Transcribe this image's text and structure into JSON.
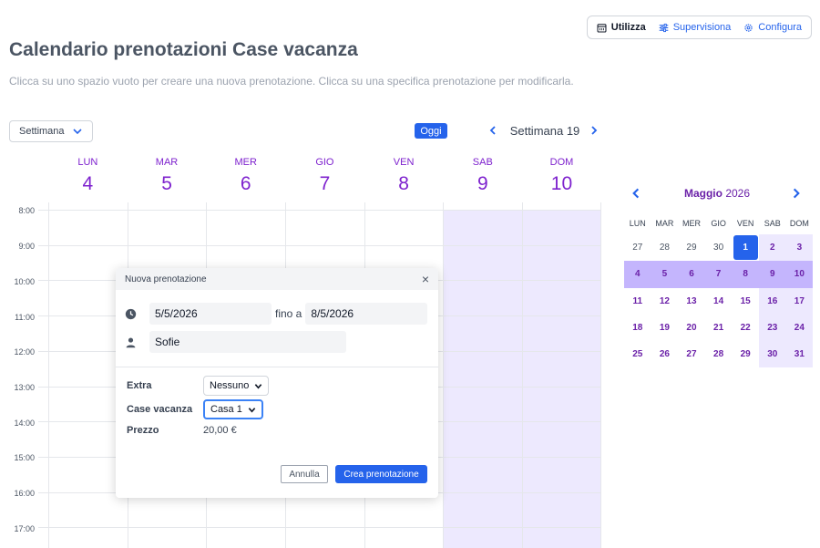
{
  "nav": {
    "use_label": "Utilizza",
    "supervise_label": "Supervisiona",
    "configure_label": "Configura"
  },
  "page": {
    "title": "Calendario prenotazioni Case vacanza",
    "subtitle": "Clicca su uno spazio vuoto per creare una nuova prenotazione. Clicca su una specifica prenotazione per modificarla."
  },
  "toolbar": {
    "view_value": "Settimana",
    "today_label": "Oggi",
    "week_label": "Settimana 19"
  },
  "week": {
    "days": [
      {
        "name": "LUN",
        "num": "4"
      },
      {
        "name": "MAR",
        "num": "5"
      },
      {
        "name": "MER",
        "num": "6"
      },
      {
        "name": "GIO",
        "num": "7"
      },
      {
        "name": "VEN",
        "num": "8"
      },
      {
        "name": "SAB",
        "num": "9"
      },
      {
        "name": "DOM",
        "num": "10"
      }
    ],
    "times": [
      "8:00",
      "9:00",
      "10:00",
      "11:00",
      "12:00",
      "13:00",
      "14:00",
      "15:00",
      "16:00",
      "17:00"
    ]
  },
  "popup": {
    "title": "Nuova prenotazione",
    "close": "×",
    "start_date": "5/5/2026",
    "until_label": "fino a",
    "end_date": "8/5/2026",
    "guest_name": "Sofie",
    "extra_label": "Extra",
    "extra_value": "Nessuno",
    "house_label": "Case vacanza",
    "house_value": "Casa 1",
    "price_label": "Prezzo",
    "price_value": "20,00 €",
    "cancel_label": "Annulla",
    "create_label": "Crea prenotazione"
  },
  "mini_calendar": {
    "month": "Maggio",
    "year": "2026",
    "weekdays": [
      "LUN",
      "MAR",
      "MER",
      "GIO",
      "VEN",
      "SAB",
      "DOM"
    ],
    "weeks": [
      [
        "27",
        "28",
        "29",
        "30",
        "1",
        "2",
        "3"
      ],
      [
        "4",
        "5",
        "6",
        "7",
        "8",
        "9",
        "10"
      ],
      [
        "11",
        "12",
        "13",
        "14",
        "15",
        "16",
        "17"
      ],
      [
        "18",
        "19",
        "20",
        "21",
        "22",
        "23",
        "24"
      ],
      [
        "25",
        "26",
        "27",
        "28",
        "29",
        "30",
        "31"
      ]
    ]
  },
  "colors": {
    "accent": "#2563eb",
    "purple_text": "#7e22ce",
    "weekend_bg": "#ede9fe",
    "selected_week_bg": "#c4b5fd"
  }
}
